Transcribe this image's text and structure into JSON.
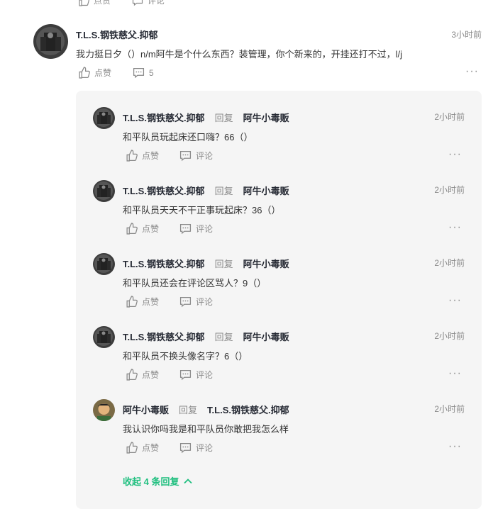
{
  "top_partial": {
    "like_label": "点赞",
    "comment_label": "评论"
  },
  "main_comment": {
    "author": "T.L.S.钢铁慈父.抑郁",
    "time": "3小时前",
    "text": "我力挺日夕（）n/m阿牛是个什么东西？装管理，你个新来的，开挂还打不过，l/j",
    "like_label": "点赞",
    "comment_count": "5",
    "more": "···"
  },
  "replies": [
    {
      "author": "T.L.S.钢铁慈父.抑郁",
      "reply_word": "回复",
      "target": "阿牛小毒贩",
      "time": "2小时前",
      "text": "和平队员玩起床还口嗨？66（）",
      "like_label": "点赞",
      "comment_label": "评论",
      "more": "···"
    },
    {
      "author": "T.L.S.钢铁慈父.抑郁",
      "reply_word": "回复",
      "target": "阿牛小毒贩",
      "time": "2小时前",
      "text": "和平队员天天不干正事玩起床？36（）",
      "like_label": "点赞",
      "comment_label": "评论",
      "more": "···"
    },
    {
      "author": "T.L.S.钢铁慈父.抑郁",
      "reply_word": "回复",
      "target": "阿牛小毒贩",
      "time": "2小时前",
      "text": "和平队员还会在评论区骂人？9（）",
      "like_label": "点赞",
      "comment_label": "评论",
      "more": "···"
    },
    {
      "author": "T.L.S.钢铁慈父.抑郁",
      "reply_word": "回复",
      "target": "阿牛小毒贩",
      "time": "2小时前",
      "text": "和平队员不换头像名字？6（）",
      "like_label": "点赞",
      "comment_label": "评论",
      "more": "···"
    },
    {
      "author": "阿牛小毒贩",
      "reply_word": "回复",
      "target": "T.L.S.钢铁慈父.抑郁",
      "time": "2小时前",
      "text": "我认识你吗我是和平队员你敢把我怎么样",
      "like_label": "点赞",
      "comment_label": "评论",
      "more": "···"
    }
  ],
  "collapse_label": "收起 4 条回复",
  "colors": {
    "accent": "#1fbf7f",
    "muted": "#8a8a8a",
    "panel": "#f5f5f5"
  }
}
